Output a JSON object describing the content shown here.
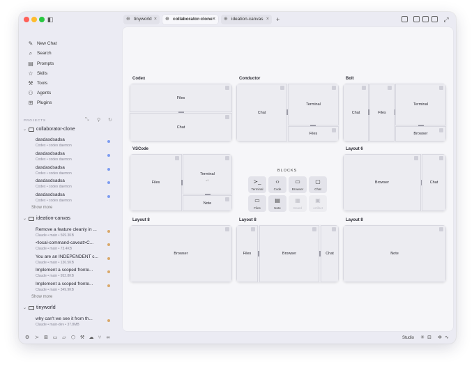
{
  "tabs": [
    {
      "label": "tinyworld",
      "active": false
    },
    {
      "label": "collaborator-clone",
      "active": true
    },
    {
      "label": "ideation-canvas",
      "active": false
    }
  ],
  "nav": [
    {
      "label": "New Chat",
      "icon": "pencil-icon"
    },
    {
      "label": "Search",
      "icon": "search-icon"
    },
    {
      "label": "Prompts",
      "icon": "document-icon"
    },
    {
      "label": "Skills",
      "icon": "star-icon"
    },
    {
      "label": "Tools",
      "icon": "tools-icon"
    },
    {
      "label": "Agents",
      "icon": "person-icon"
    },
    {
      "label": "Plugins",
      "icon": "plugin-icon"
    }
  ],
  "projects_label": "PROJECTS",
  "groups": [
    {
      "name": "collaborator-clone",
      "sessions": [
        {
          "title": "dasdasdsadsa",
          "subtitle": "Codex • codex daemon",
          "dot": "#7d9cf0"
        },
        {
          "title": "dasdasdsadsa",
          "subtitle": "Codex • codex daemon",
          "dot": "#7d9cf0"
        },
        {
          "title": "dasdasdsadsa",
          "subtitle": "Codex • codex daemon",
          "dot": "#7d9cf0"
        },
        {
          "title": "dasdasdsadsa",
          "subtitle": "Codex • codex daemon",
          "dot": "#7d9cf0"
        },
        {
          "title": "dasdasdsadsa",
          "subtitle": "Codex • codex daemon",
          "dot": "#7d9cf0"
        }
      ],
      "show_more": "Show more"
    },
    {
      "name": "ideation-canvas",
      "sessions": [
        {
          "title": "Remove a feature cleanly in ...",
          "subtitle": "Claude • main • 569.3KB",
          "dot": "#d9a86a"
        },
        {
          "title": "<local-command-caveat>C...",
          "subtitle": "Claude • main • 73.4KB",
          "dot": "#d9a86a"
        },
        {
          "title": "You are an INDEPENDENT c...",
          "subtitle": "Claude • main • 136.5KB",
          "dot": "#d9a86a"
        },
        {
          "title": "Implement a scoped fronte...",
          "subtitle": "Claude • main • 952.8KB",
          "dot": "#d9a86a"
        },
        {
          "title": "Implement a scoped fronte...",
          "subtitle": "Claude • main • 349.9KB",
          "dot": "#d9a86a"
        }
      ],
      "show_more": "Show more"
    },
    {
      "name": "tinyworld",
      "sessions": [
        {
          "title": "why can't we see it from th...",
          "subtitle": "Claude • main-dev • 37.8MB",
          "dot": "#d9a86a"
        }
      ]
    }
  ],
  "bottom": {
    "studio_label": "Studio"
  },
  "layouts": {
    "codex": {
      "title": "Codex",
      "panes": [
        "Files",
        "Chat"
      ]
    },
    "conductor": {
      "title": "Conductor",
      "panes": [
        "Chat",
        "Terminal",
        "Files"
      ]
    },
    "bolt": {
      "title": "Bolt",
      "panes": [
        "Chat",
        "Files",
        "Terminal",
        "Browser"
      ]
    },
    "vscode": {
      "title": "VSCode",
      "panes": [
        "Files",
        "Terminal",
        "Note"
      ],
      "terminal_sub": "v1"
    },
    "layout6": {
      "title": "Layout 6",
      "panes": [
        "Browser",
        "Chat"
      ]
    },
    "layout8a": {
      "title": "Layout 8",
      "panes": [
        "Browser"
      ]
    },
    "layout8b": {
      "title": "Layout 8",
      "panes": [
        "Files",
        "Browser",
        "Chat"
      ]
    },
    "layout8c": {
      "title": "Layout 8",
      "panes": [
        "Note"
      ]
    }
  },
  "blocks": {
    "title": "BLOCKS",
    "items": [
      {
        "label": "Terminal",
        "icon": "terminal-icon",
        "glyph": "≻_",
        "enabled": true
      },
      {
        "label": "Code",
        "icon": "code-icon",
        "glyph": "‹›",
        "enabled": true
      },
      {
        "label": "Browser",
        "icon": "browser-icon",
        "glyph": "▭",
        "enabled": true
      },
      {
        "label": "Chat",
        "icon": "chat-icon",
        "glyph": "▢",
        "enabled": true
      },
      {
        "label": "Files",
        "icon": "folder-icon",
        "glyph": "▭",
        "enabled": true
      },
      {
        "label": "Note",
        "icon": "note-icon",
        "glyph": "▤",
        "enabled": true
      },
      {
        "label": "Board",
        "icon": "board-icon",
        "glyph": "▦",
        "enabled": false
      },
      {
        "label": "Artifact",
        "icon": "artifact-icon",
        "glyph": "▣",
        "enabled": false
      }
    ]
  }
}
